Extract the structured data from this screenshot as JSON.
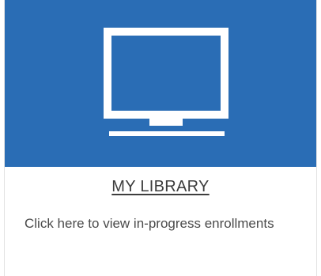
{
  "card": {
    "title": "MY LIBRARY",
    "description": "Click here to view in-progress enrollments",
    "icon": "monitor-icon"
  },
  "colors": {
    "banner": "#2a6db5",
    "icon": "#ffffff",
    "title_text": "#3d3d3d",
    "description_text": "#4a4a4a"
  }
}
